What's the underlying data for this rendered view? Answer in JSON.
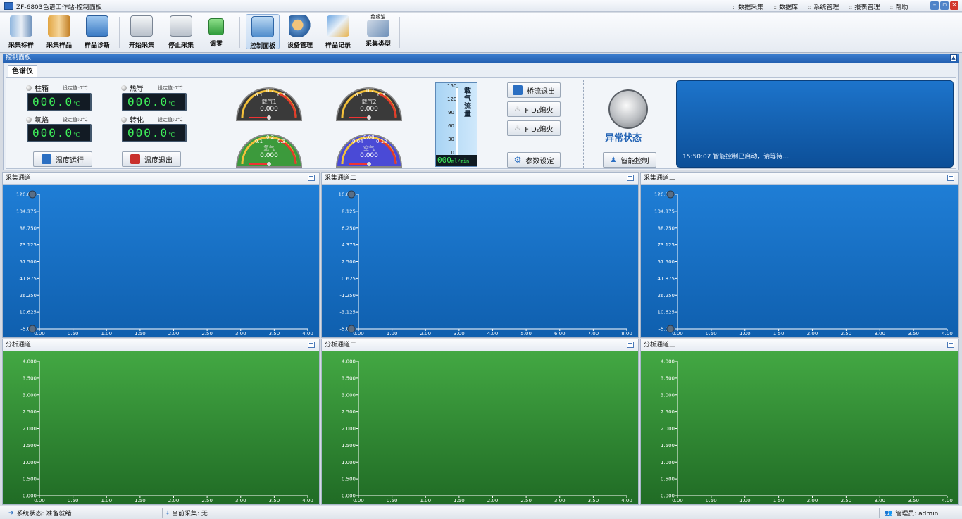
{
  "app": {
    "title": "ZF-6803色谱工作站-控制面板"
  },
  "menu": [
    "数据采集",
    "数据库",
    "系统管理",
    "报表管理",
    "帮助"
  ],
  "toolbar": [
    {
      "label": "采集标样",
      "icon": "standard-sample-icon"
    },
    {
      "label": "采集样品",
      "icon": "sample-collect-icon"
    },
    {
      "label": "样品诊断",
      "icon": "diagnosis-icon"
    },
    {
      "label": "开始采集",
      "icon": "start-collect-icon"
    },
    {
      "label": "停止采集",
      "icon": "stop-collect-icon"
    },
    {
      "label": "调零",
      "icon": "zero-adjust-icon"
    },
    {
      "label": "控制面板",
      "icon": "control-panel-icon",
      "active": true
    },
    {
      "label": "设备管理",
      "icon": "device-manage-icon"
    },
    {
      "label": "样品记录",
      "icon": "sample-record-icon"
    },
    {
      "label": "采集类型",
      "icon": "collect-type-icon",
      "badge": "绝缘油"
    }
  ],
  "panel": {
    "title": "控制面板",
    "tab": "色谱仪",
    "temps": [
      {
        "name": "柱箱",
        "set": "设定值:0℃",
        "value": "000.0",
        "unit": "℃"
      },
      {
        "name": "热导",
        "set": "设定值:0℃",
        "value": "000.0",
        "unit": "℃"
      },
      {
        "name": "氢焰",
        "set": "设定值:0℃",
        "value": "000.0",
        "unit": "℃"
      },
      {
        "name": "转化",
        "set": "设定值:0℃",
        "value": "000.0",
        "unit": "℃"
      }
    ],
    "temp_run": "温度运行",
    "temp_exit": "温度退出",
    "gauges": [
      {
        "name": "载气1",
        "value": "0.000",
        "color": "#3a3a3a",
        "scale": [
          "0.1",
          "0.2",
          "0.3"
        ]
      },
      {
        "name": "载气2",
        "value": "0.000",
        "color": "#3a3a3a",
        "scale": [
          "0.1",
          "0.2",
          "0.3"
        ]
      },
      {
        "name": "氢气",
        "value": "0.000",
        "color": "#3c9a3c",
        "scale": [
          "0.1",
          "0.2",
          "0.3"
        ]
      },
      {
        "name": "空气",
        "value": "0.000",
        "color": "#4a4ad6",
        "scale": [
          "0.04",
          "0.08",
          "0.12"
        ]
      }
    ],
    "flow": {
      "label": "载气流量",
      "ticks": [
        "150",
        "120",
        "90",
        "60",
        "30",
        "0"
      ],
      "value": "000",
      "unit": "ml/min"
    },
    "bridge_exit": "桥流退出",
    "fid1": "FID₁熄火",
    "fid2": "FID₂熄火",
    "params": "参数设定",
    "alarm_label": "异常状态",
    "smart": "智能控制",
    "message": "15:50:07  智能控制已启动，请等待…"
  },
  "charts": [
    {
      "title": "采集通道一",
      "y": [
        "120.000",
        "104.375",
        "88.750",
        "73.125",
        "57.500",
        "41.875",
        "26.250",
        "10.625",
        "-5.000"
      ],
      "x": [
        "0.00",
        "0.50",
        "1.00",
        "1.50",
        "2.00",
        "2.50",
        "3.00",
        "3.50",
        "4.00"
      ]
    },
    {
      "title": "采集通道二",
      "y": [
        "10.000",
        "8.125",
        "6.250",
        "4.375",
        "2.500",
        "0.625",
        "-1.250",
        "-3.125",
        "-5.000"
      ],
      "x": [
        "0.00",
        "1.00",
        "2.00",
        "3.00",
        "4.00",
        "5.00",
        "6.00",
        "7.00",
        "8.00"
      ]
    },
    {
      "title": "采集通道三",
      "y": [
        "120.000",
        "104.375",
        "88.750",
        "73.125",
        "57.500",
        "41.875",
        "26.250",
        "10.625",
        "-5.000"
      ],
      "x": [
        "0.00",
        "0.50",
        "1.00",
        "1.50",
        "2.00",
        "2.50",
        "3.00",
        "3.50",
        "4.00"
      ]
    },
    {
      "title": "分析通道一",
      "y": [
        "4.000",
        "3.500",
        "3.000",
        "2.500",
        "2.000",
        "1.500",
        "1.000",
        "0.500",
        "0.000"
      ],
      "x": [
        "0.00",
        "0.50",
        "1.00",
        "1.50",
        "2.00",
        "2.50",
        "3.00",
        "3.50",
        "4.00"
      ]
    },
    {
      "title": "分析通道二",
      "y": [
        "4.000",
        "3.500",
        "3.000",
        "2.500",
        "2.000",
        "1.500",
        "1.000",
        "0.500",
        "0.000"
      ],
      "x": [
        "0.00",
        "0.50",
        "1.00",
        "1.50",
        "2.00",
        "2.50",
        "3.00",
        "3.50",
        "4.00"
      ]
    },
    {
      "title": "分析通道三",
      "y": [
        "4.000",
        "3.500",
        "3.000",
        "2.500",
        "2.000",
        "1.500",
        "1.000",
        "0.500",
        "0.000"
      ],
      "x": [
        "0.00",
        "0.50",
        "1.00",
        "1.50",
        "2.00",
        "2.50",
        "3.00",
        "3.50",
        "4.00"
      ]
    }
  ],
  "status": {
    "system": "系统状态: 准备就绪",
    "current": "当前采集: 无",
    "admin": "管理员: admin"
  }
}
